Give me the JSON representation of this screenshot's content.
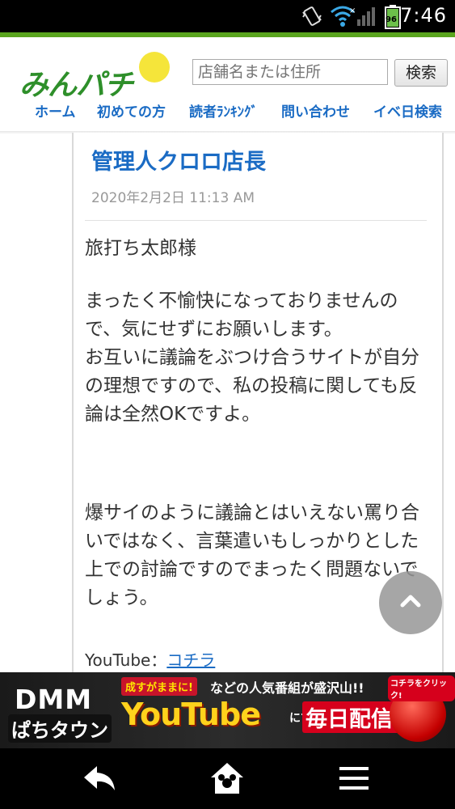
{
  "status_bar": {
    "time": "7:46",
    "battery_level": "96",
    "icons": [
      "vibrate-icon",
      "wifi-icon",
      "signal-icon",
      "battery-icon"
    ]
  },
  "header": {
    "logo_text": "みんパチ",
    "search": {
      "placeholder": "店舗名または住所",
      "button_label": "検索"
    },
    "nav": [
      "ホーム",
      "初めての方",
      "読者ﾗﾝｷﾝｸﾞ",
      "問い合わせ",
      "イベ日検索"
    ]
  },
  "post": {
    "author": "管理人クロロ店長",
    "date": "2020年2月2日 11:13 AM",
    "greeting": "旅打ち太郎様",
    "paragraph1": "まったく不愉快になっておりませんので、気にせずにお願いします。\nお互いに議論をぶつけ合うサイトが自分の理想ですので、私の投稿に関しても反論は全然OKですよ。",
    "paragraph2": "爆サイのように議論とはいえない罵り合いではなく、言葉遣いもしっかりとした上での討論ですのでまったく問題ないでしょう。",
    "youtube_label": "YouTube：",
    "youtube_link": "コチラ"
  },
  "ad": {
    "brand": "DMM",
    "brand_sub": "ぱちタウン",
    "badge": "成すがままに!",
    "headline": "などの人気番組が盛沢山!!",
    "youtube": "YouTube",
    "ni": "にて",
    "stream": "毎日配信中!!",
    "button_label": "コチラをクリック!"
  },
  "colors": {
    "accent_green": "#5aa51e",
    "link_blue": "#1a6bc4",
    "logo_yellow": "#f5e53a"
  }
}
